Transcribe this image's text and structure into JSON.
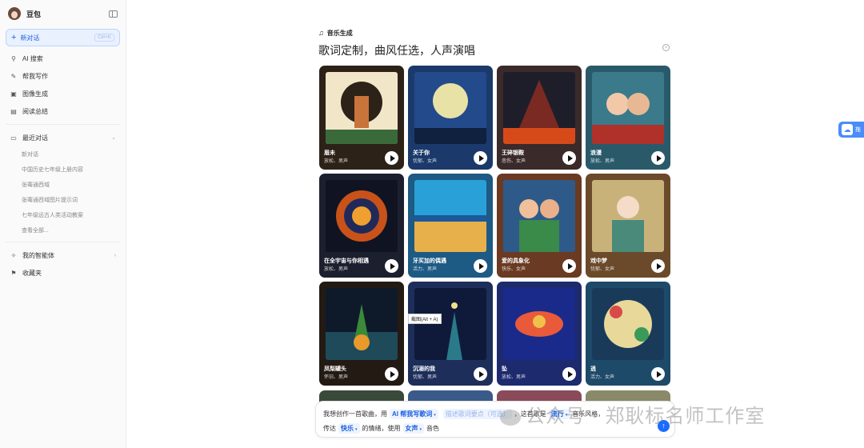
{
  "app": {
    "name": "豆包"
  },
  "sidebar": {
    "new_chat": {
      "label": "新对话",
      "shortcut": "Ctrl+K"
    },
    "nav": [
      {
        "label": "AI 搜索",
        "icon": "search-icon",
        "glyph": "⚲"
      },
      {
        "label": "帮我写作",
        "icon": "pen-icon",
        "glyph": "✎"
      },
      {
        "label": "图像生成",
        "icon": "image-icon",
        "glyph": "▣"
      },
      {
        "label": "阅读总结",
        "icon": "book-icon",
        "glyph": "▤"
      }
    ],
    "recent": {
      "label": "最近对话",
      "items": [
        "新对话",
        "中国历史七年级上册内容",
        "张骞通西域",
        "张骞通西域图片提示词",
        "七年级远古人类活动教案",
        "查看全部..."
      ]
    },
    "agents": {
      "label": "我的智能体"
    },
    "favorites": {
      "label": "收藏夹"
    }
  },
  "main": {
    "mode_label": "音乐生成",
    "headline": "歌词定制，曲风任选，人声演唱",
    "tooltip": "截图(Alt + A)",
    "cards": [
      {
        "title": "眉未",
        "tags": "放松、男声",
        "bg": "#2c2218"
      },
      {
        "title": "关于你",
        "tags": "忧郁、女声",
        "bg": "#1b3a6b"
      },
      {
        "title": "王碎银鞍",
        "tags": "悲伤、女声",
        "bg": "#3a2a2a"
      },
      {
        "title": "浪漫",
        "tags": "放松、男声",
        "bg": "#2a5a6a"
      },
      {
        "title": "在全宇宙与你相遇",
        "tags": "放松、男声",
        "bg": "#1c1f2e"
      },
      {
        "title": "牙买加的偶遇",
        "tags": "活力、男声",
        "bg": "#1d5a84"
      },
      {
        "title": "爱的具象化",
        "tags": "快乐、女声",
        "bg": "#6a3a22"
      },
      {
        "title": "戏中梦",
        "tags": "忧郁、女声",
        "bg": "#6a4a2a"
      },
      {
        "title": "凤梨罐头",
        "tags": "怀旧、男声",
        "bg": "#241a14"
      },
      {
        "title": "沉溺的我",
        "tags": "忧郁、男声",
        "bg": "#1e2e5a"
      },
      {
        "title": "坠",
        "tags": "放松、男声",
        "bg": "#1e2a6e"
      },
      {
        "title": "逍",
        "tags": "活力、女声",
        "bg": "#1e4a6a"
      }
    ],
    "partial_colors": [
      "#3a4a3a",
      "#3a5a8a",
      "#8a4a5a",
      "#8a8a6a"
    ]
  },
  "composer": {
    "line1": {
      "p1": "我想创作一首歌曲，用",
      "chip1": "AI 帮我写歌词",
      "placeholder": "描述歌词要点（可选）",
      "p2": "，这首歌是",
      "chip2": "流行",
      "p3": "音乐风格，"
    },
    "line2": {
      "p1": "传达",
      "chip1": "快乐",
      "p2": "的情绪，使用",
      "chip2": "女声",
      "p3": "音色"
    }
  },
  "watermark": "公众号 · 郑耿标名师工作室",
  "float_button": {
    "label": "拖"
  },
  "colors": {
    "accent": "#1a5fe0",
    "send": "#1a6cff"
  }
}
